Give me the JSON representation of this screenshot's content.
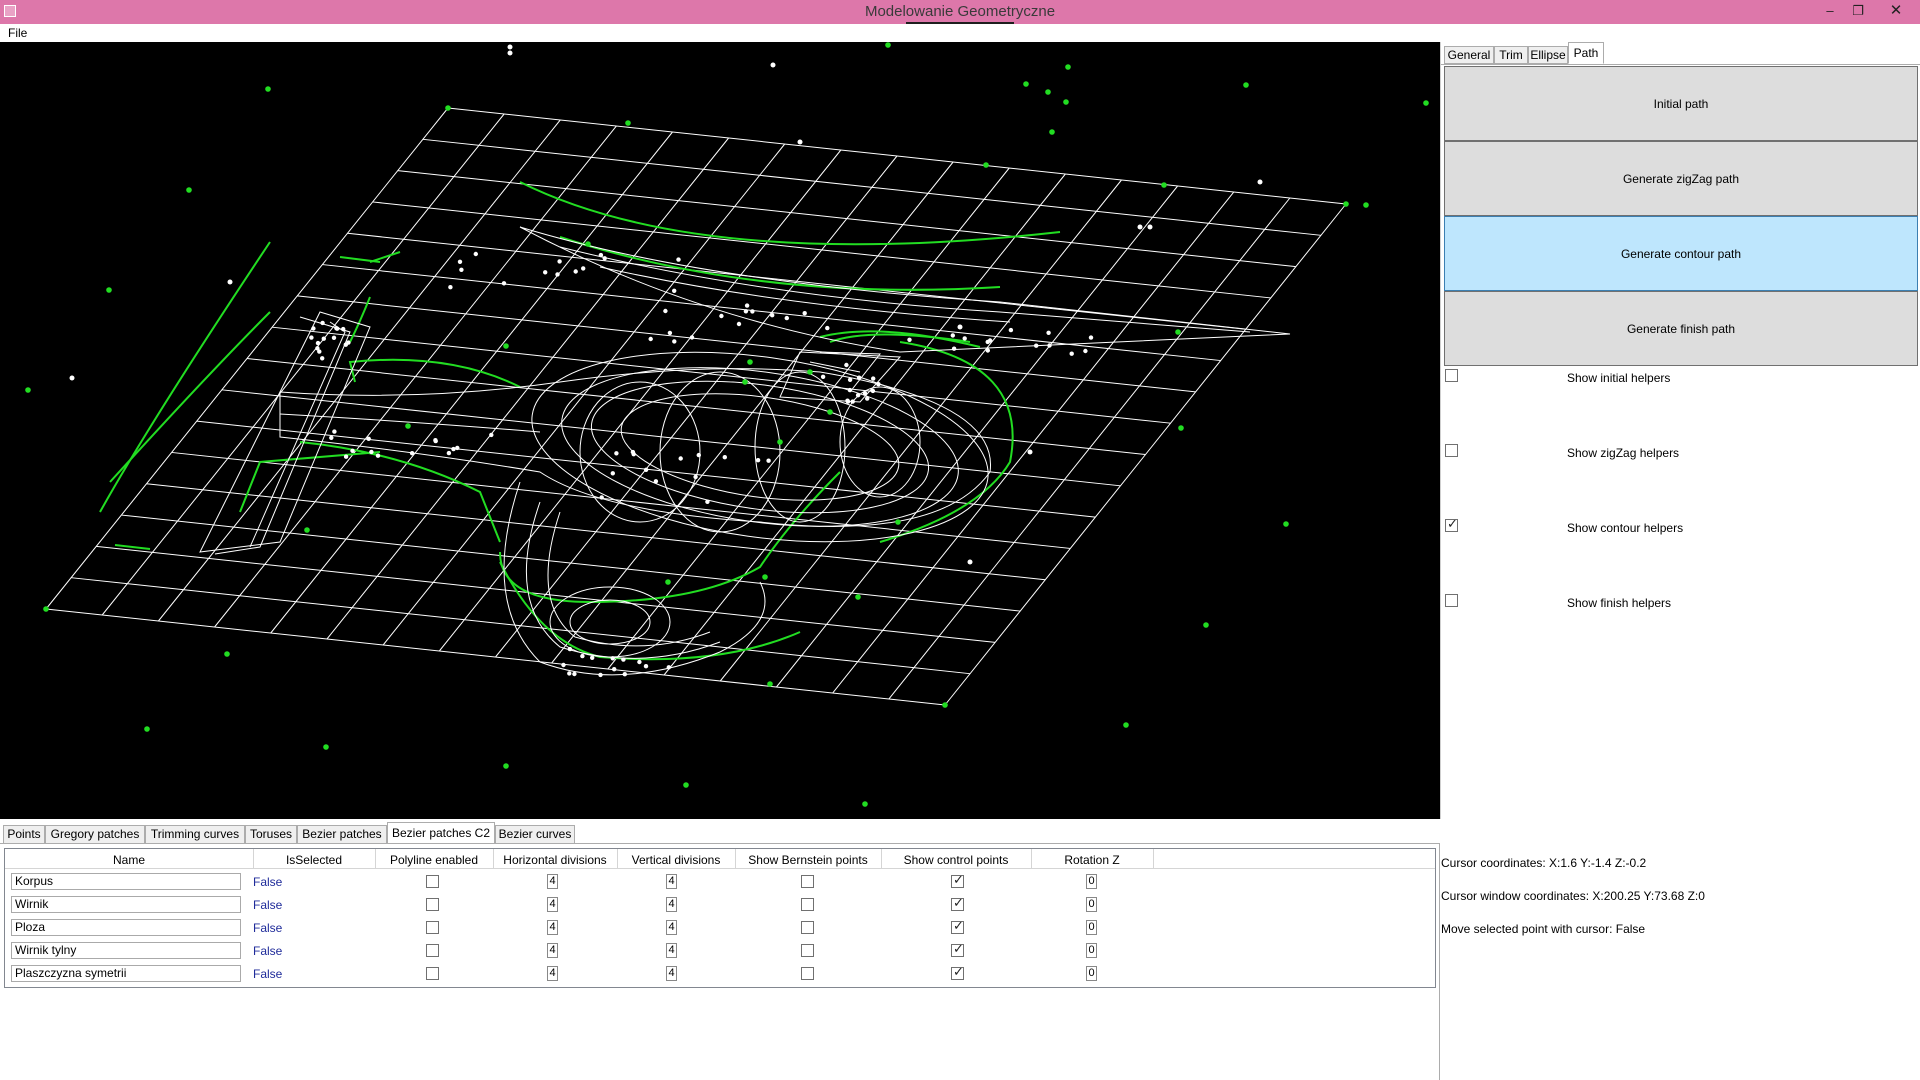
{
  "window": {
    "title": "Modelowanie Geometryczne"
  },
  "menu": {
    "file": "File"
  },
  "right_tabs": [
    "General",
    "Trim",
    "Ellipse",
    "Path"
  ],
  "path_panel": {
    "buttons": {
      "initial": "Initial path",
      "zigzag": "Generate zigZag path",
      "contour": "Generate contour path",
      "finish": "Generate finish path"
    },
    "checkboxes": [
      {
        "label": "Show initial helpers",
        "checked": false
      },
      {
        "label": "Show zigZag helpers",
        "checked": false
      },
      {
        "label": "Show contour helpers",
        "checked": true
      },
      {
        "label": "Show finish helpers",
        "checked": false
      }
    ]
  },
  "bottom_tabs": [
    "Points",
    "Gregory patches",
    "Trimming curves",
    "Toruses",
    "Bezier patches",
    "Bezier patches C2",
    "Bezier curves"
  ],
  "patch_table": {
    "headers": [
      "Name",
      "IsSelected",
      "Polyline enabled",
      "Horizontal divisions",
      "Vertical divisions",
      "Show Bernstein points",
      "Show control points",
      "Rotation Z"
    ],
    "rows": [
      {
        "name": "Korpus",
        "is_selected": "False",
        "polyline": false,
        "h_div": "4",
        "v_div": "4",
        "bernstein": false,
        "control": true,
        "rotation": "0"
      },
      {
        "name": "Wirnik",
        "is_selected": "False",
        "polyline": false,
        "h_div": "4",
        "v_div": "4",
        "bernstein": false,
        "control": true,
        "rotation": "0"
      },
      {
        "name": "Ploza",
        "is_selected": "False",
        "polyline": false,
        "h_div": "4",
        "v_div": "4",
        "bernstein": false,
        "control": true,
        "rotation": "0"
      },
      {
        "name": "Wirnik tylny",
        "is_selected": "False",
        "polyline": false,
        "h_div": "4",
        "v_div": "4",
        "bernstein": false,
        "control": true,
        "rotation": "0"
      },
      {
        "name": "Plaszczyzna symetrii",
        "is_selected": "False",
        "polyline": false,
        "h_div": "4",
        "v_div": "4",
        "bernstein": false,
        "control": true,
        "rotation": "0"
      }
    ]
  },
  "status": {
    "cursor": "Cursor coordinates: X:1.6 Y:-1.4 Z:-0.2",
    "cursor_window": "Cursor window coordinates: X:200.25 Y:73.68 Z:0",
    "move_selected": "Move selected point with cursor: False"
  },
  "colors": {
    "titlebar": "#dd77aa",
    "viewport": "#000000",
    "wireframe": "#ffffff",
    "control_points": "#22dd22",
    "hover_button": "#bee6fd"
  }
}
